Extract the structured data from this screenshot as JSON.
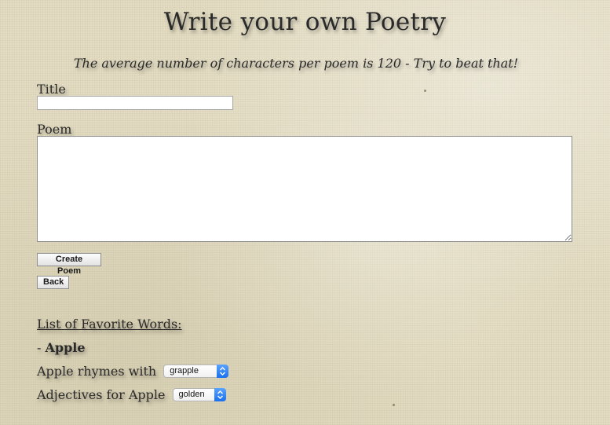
{
  "page": {
    "title": "Write your own Poetry",
    "tagline": "The average number of characters per poem is 120 - Try to beat that!"
  },
  "form": {
    "title_label": "Title",
    "title_value": "",
    "poem_label": "Poem",
    "poem_value": "",
    "create_button": "Create Poem",
    "back_button": "Back"
  },
  "favorites": {
    "heading": "List of Favorite Words:",
    "word_prefix": "- ",
    "word": "Apple",
    "rhymes_label": "Apple rhymes with",
    "rhymes_selected": "grapple",
    "adjectives_label": "Adjectives for Apple",
    "adjectives_selected": "golden"
  },
  "colors": {
    "background": "#e3dcc2",
    "text": "#2a2a2a",
    "select_accent": "#1a6fee"
  },
  "icons": {
    "select_arrows": "updown-chevron-icon"
  }
}
